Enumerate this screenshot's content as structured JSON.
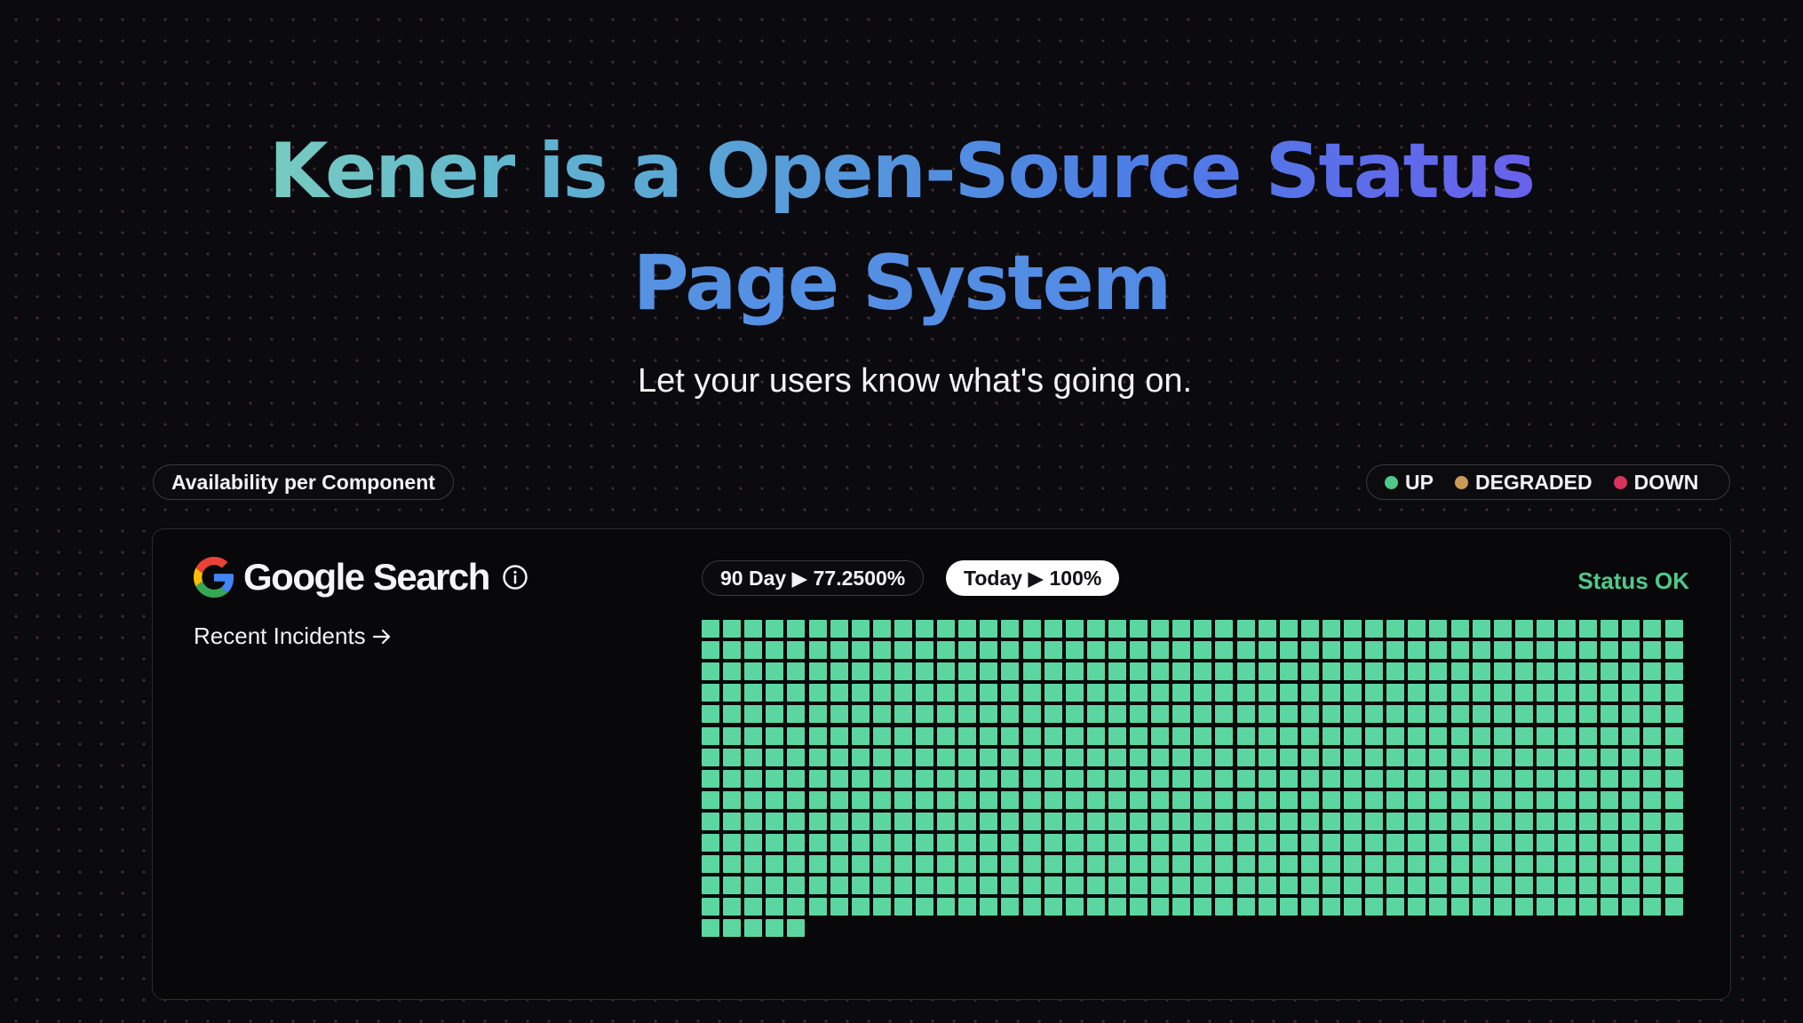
{
  "hero": {
    "title_part1": "Kener is a Open-Source Status",
    "title_part2": "Page System",
    "subtitle": "Let your users know what's going on."
  },
  "availability_label": "Availability per Component",
  "legend": [
    {
      "label": "UP",
      "color": "#4fc98a"
    },
    {
      "label": "DEGRADED",
      "color": "#c99a56"
    },
    {
      "label": "DOWN",
      "color": "#d6345f"
    }
  ],
  "monitor": {
    "name": "Google Search",
    "logo_icon": "google-g-icon",
    "info_icon": "info-icon",
    "recent_incidents_label": "Recent Incidents",
    "uptime_90_day": "90 Day ▶ 77.2500%",
    "uptime_today": "Today ▶ 100%",
    "status_text": "Status OK",
    "status_color": "#4fc98a"
  },
  "uptime_grid": {
    "columns": 46,
    "total_cells": 649,
    "up_color": "#5cd6a0"
  }
}
